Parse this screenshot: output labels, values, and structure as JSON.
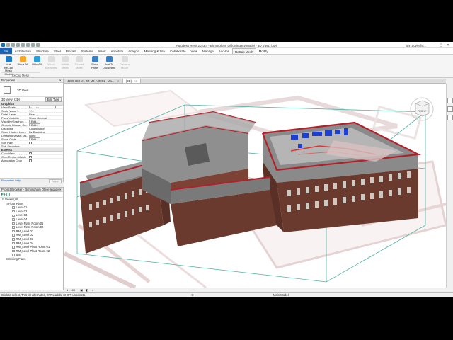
{
  "window": {
    "title": "Autodesk Revit 2023.4 - Birmingham Office legacy model - 3D View: (3D)",
    "user": "john.doyle@u...",
    "controls": [
      "–",
      "▢",
      "✕"
    ]
  },
  "ribbon_tabs": [
    "File",
    "Architecture",
    "Structure",
    "Steel",
    "Precast",
    "Systems",
    "Insert",
    "Annotate",
    "Analyze",
    "Massing & Site",
    "Collaborate",
    "View",
    "Manage",
    "Add-Ins",
    "ReCap Mesh",
    "Modify"
  ],
  "active_tab": "ReCap Mesh",
  "ribbon": {
    "buttons": [
      {
        "label": "Link ReCap Mesh Model",
        "color": "#1f7bc7",
        "enabled": true
      },
      {
        "label": "Show All",
        "color": "#f5a623",
        "enabled": true
      },
      {
        "label": "Hide All",
        "color": "#2c9fd8",
        "enabled": true
      },
      {
        "label": "Mesh Elements",
        "color": "#bbbbbb",
        "enabled": false
      },
      {
        "label": "Unlink Mesh",
        "color": "#bbbbbb",
        "enabled": false
      },
      {
        "label": "Reload Mesh",
        "color": "#bbbbbb",
        "enabled": false
      },
      {
        "label": "Show Panel",
        "color": "#3a7fc4",
        "enabled": true
      },
      {
        "label": "Add To Document",
        "color": "#3a7fc4",
        "enabled": true
      },
      {
        "label": "Preview Mode",
        "color": "#bbbbbb",
        "enabled": false
      }
    ],
    "panel_label": "ReCap Mesh"
  },
  "properties": {
    "title": "Properties",
    "type_name": "3D View",
    "instance": "3D View: {3D}",
    "edit_type": "Edit Type",
    "sections": [
      {
        "name": "Graphics",
        "rows": [
          {
            "k": "View Scale",
            "v": "1 : 100",
            "style": "boxed"
          },
          {
            "k": "Scale Value  1:",
            "v": "100",
            "style": "gray"
          },
          {
            "k": "Detail Level",
            "v": "Fine",
            "style": ""
          },
          {
            "k": "Parts Visibility",
            "v": "Show Original",
            "style": ""
          },
          {
            "k": "Visibility/Graphics ...",
            "v": "Edit...",
            "style": "btn"
          },
          {
            "k": "Graphic Display Op...",
            "v": "Edit...",
            "style": "btn"
          },
          {
            "k": "Discipline",
            "v": "Coordination",
            "style": ""
          },
          {
            "k": "Show Hidden Lines",
            "v": "By Discipline",
            "style": ""
          },
          {
            "k": "Default Analysis Dis...",
            "v": "None",
            "style": ""
          },
          {
            "k": "Show Grids",
            "v": "Edit...",
            "style": "btn"
          },
          {
            "k": "Sun Path",
            "v": "",
            "style": "chk"
          },
          {
            "k": "Sub-Discipline",
            "v": "",
            "style": ""
          }
        ]
      },
      {
        "name": "Extents",
        "rows": [
          {
            "k": "Crop View",
            "v": "",
            "style": "chk"
          },
          {
            "k": "Crop Region Visible",
            "v": "",
            "style": "chk"
          },
          {
            "k": "Annotation Crop",
            "v": "",
            "style": "chk"
          }
        ]
      }
    ],
    "help_link": "Properties help",
    "apply": "Apply"
  },
  "browser": {
    "title": "Project Browser - Birmingham Office legacy m...",
    "tree": [
      {
        "label": "Views (all)",
        "depth": 0,
        "exp": "⊟"
      },
      {
        "label": "Floor Plans",
        "depth": 1,
        "exp": "⊟"
      },
      {
        "label": "Level 01",
        "depth": 2,
        "exp": ""
      },
      {
        "label": "Level 02",
        "depth": 2,
        "exp": ""
      },
      {
        "label": "Level 03",
        "depth": 2,
        "exp": ""
      },
      {
        "label": "Level 04",
        "depth": 2,
        "exp": ""
      },
      {
        "label": "Level Plant Room 01",
        "depth": 2,
        "exp": ""
      },
      {
        "label": "Level Plant Room 02",
        "depth": 2,
        "exp": ""
      },
      {
        "label": "RM_Level 01",
        "depth": 2,
        "exp": ""
      },
      {
        "label": "RM_Level 02",
        "depth": 2,
        "exp": ""
      },
      {
        "label": "RM_Level 03",
        "depth": 2,
        "exp": ""
      },
      {
        "label": "RM_Level 04",
        "depth": 2,
        "exp": ""
      },
      {
        "label": "RM_Level Plant Room 01",
        "depth": 2,
        "exp": ""
      },
      {
        "label": "RM_Level Plant Room 02",
        "depth": 2,
        "exp": ""
      },
      {
        "label": "Site",
        "depth": 2,
        "exp": ""
      },
      {
        "label": "Ceiling Plans",
        "depth": 1,
        "exp": "⊞"
      }
    ]
  },
  "view_tabs": [
    {
      "label": "4289-3B0-V1-ZZ-M3-A-0001 - Ma...",
      "active": false
    },
    {
      "label": "{3D}",
      "active": true
    }
  ],
  "view_control": "1 : 100",
  "status": {
    "hint": "Click to select, TAB for alternates, CTRL adds, SHIFT unselects.",
    "main": ":0",
    "model": "Main Model"
  },
  "colors": {
    "brick": "#6b3a2e",
    "roof_trim": "#b3202a",
    "floor": "#8a8a8a",
    "mep_blue": "#1c3fd0",
    "section_box": "#4fb3a4",
    "ghost": "#c9b0b0"
  }
}
